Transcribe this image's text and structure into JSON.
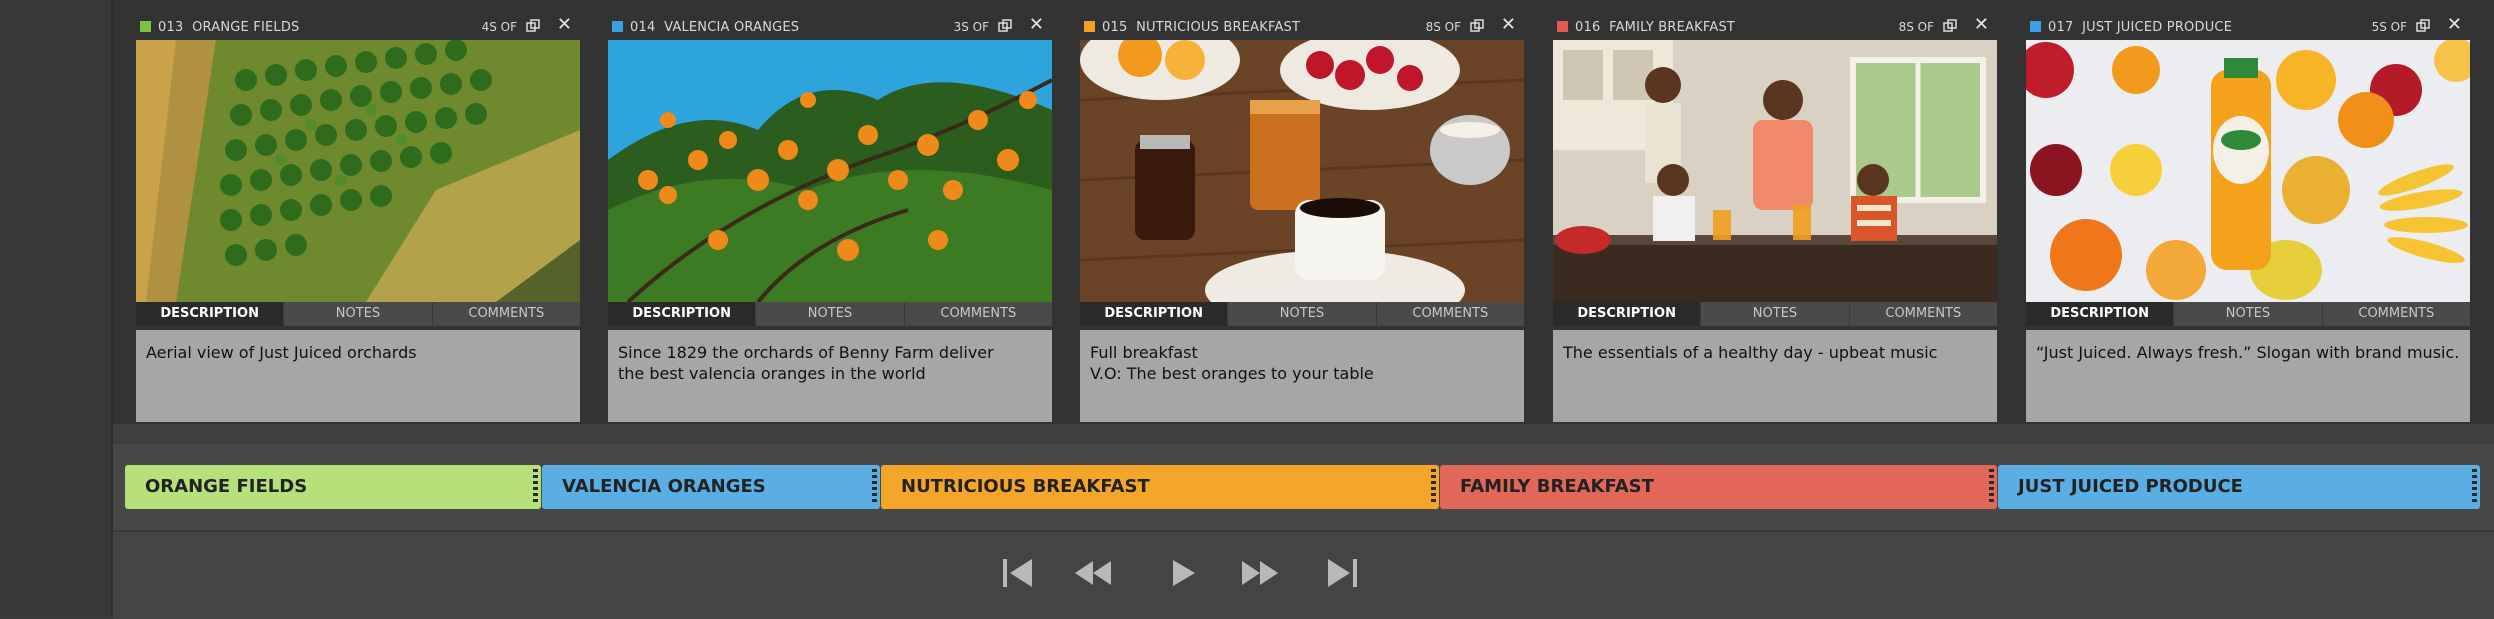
{
  "cards": [
    {
      "number": "013",
      "name": "ORANGE FIELDS",
      "duration": "4S OF",
      "color": "#7dc243",
      "tabs": [
        "DESCRIPTION",
        "NOTES",
        "COMMENTS"
      ],
      "active_tab": "DESCRIPTION",
      "description": "Aerial view of Just Juiced orchards",
      "image": "aerial-orchard-image"
    },
    {
      "number": "014",
      "name": "VALENCIA ORANGES",
      "duration": "3S OF",
      "color": "#3aa0e0",
      "tabs": [
        "DESCRIPTION",
        "NOTES",
        "COMMENTS"
      ],
      "active_tab": "DESCRIPTION",
      "description": "Since 1829 the orchards of Benny Farm deliver\nthe best valencia oranges in the world",
      "image": "orange-tree-image"
    },
    {
      "number": "015",
      "name": "NUTRICIOUS  BREAKFAST",
      "duration": "8S OF",
      "color": "#f3a123",
      "tabs": [
        "DESCRIPTION",
        "NOTES",
        "COMMENTS"
      ],
      "active_tab": "DESCRIPTION",
      "description": "Full breakfast\nV.O: The best oranges to your table",
      "image": "breakfast-table-image"
    },
    {
      "number": "016",
      "name": "FAMILY BREAKFAST",
      "duration": "8S OF",
      "color": "#e55a4e",
      "tabs": [
        "DESCRIPTION",
        "NOTES",
        "COMMENTS"
      ],
      "active_tab": "DESCRIPTION",
      "description": "The essentials of a healthy day - upbeat music",
      "image": "family-kitchen-image"
    },
    {
      "number": "017",
      "name": "JUST JUICED PRODUCE",
      "duration": "5S OF",
      "color": "#3aa0e0",
      "tabs": [
        "DESCRIPTION",
        "NOTES",
        "COMMENTS"
      ],
      "active_tab": "DESCRIPTION",
      "description": "“Just Juiced. Always fresh.” Slogan with brand music.",
      "image": "juice-produce-image"
    }
  ],
  "timeline": [
    {
      "label": "ORANGE FIELDS",
      "color": "#b5e07a"
    },
    {
      "label": "VALENCIA ORANGES",
      "color": "#5aaee3"
    },
    {
      "label": "NUTRICIOUS BREAKFAST",
      "color": "#f3a62a"
    },
    {
      "label": "FAMILY BREAKFAST",
      "color": "#e0675a"
    },
    {
      "label": "JUST JUICED PRODUCE",
      "color": "#5aaee3"
    }
  ],
  "transport": [
    "skip-to-start-icon",
    "rewind-icon",
    "play-icon",
    "fast-forward-icon",
    "skip-to-end-icon"
  ]
}
